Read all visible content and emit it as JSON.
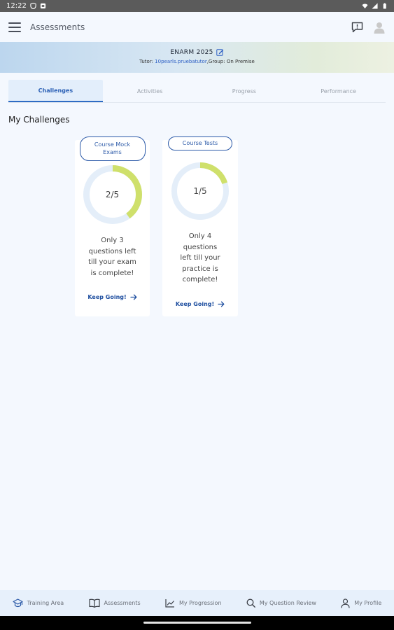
{
  "status_bar": {
    "time": "12:22"
  },
  "app_bar": {
    "title": "Assessments"
  },
  "banner": {
    "course": "ENARM 2025",
    "tutor_prefix": "Tutor: ",
    "tutor_name": "10pearls.pruebatutor",
    "group_text": ",Group: On Premise"
  },
  "tabs": [
    {
      "label": "Challenges",
      "active": true
    },
    {
      "label": "Activities",
      "active": false
    },
    {
      "label": "Progress",
      "active": false
    },
    {
      "label": "Performance",
      "active": false
    }
  ],
  "section_title": "My Challenges",
  "cards": [
    {
      "pill": "Course Mock Exams",
      "progress_label": "2/5",
      "progress": 0.4,
      "message": "Only 3 questions left till your exam is complete!",
      "cta": "Keep Going!"
    },
    {
      "pill": "Course Tests",
      "progress_label": "1/5",
      "progress": 0.2,
      "message": "Only 4 questions left till your practice is complete!",
      "cta": "Keep Going!"
    }
  ],
  "bottom_nav": [
    {
      "label": "Training Area",
      "icon": "graduation-cap-icon"
    },
    {
      "label": "Assessments",
      "icon": "book-icon"
    },
    {
      "label": "My Progression",
      "icon": "chart-line-icon"
    },
    {
      "label": "My Question Review",
      "icon": "search-icon"
    },
    {
      "label": "My Profile",
      "icon": "user-icon"
    }
  ],
  "colors": {
    "accent": "#2c5aa8",
    "progress_fill": "#cfe06b",
    "progress_track": "#e4eef9",
    "background": "#f4f8fe"
  }
}
